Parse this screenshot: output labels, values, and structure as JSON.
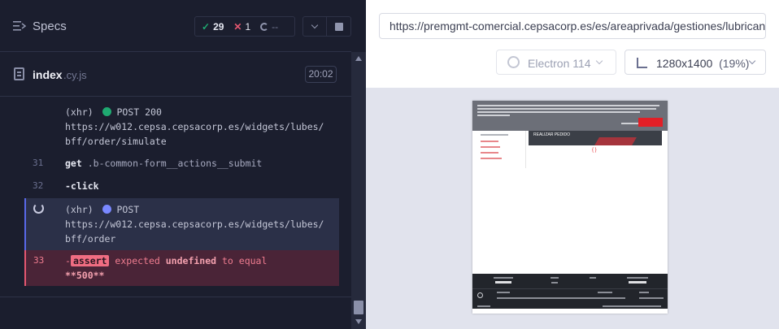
{
  "reporter": {
    "title": "Specs",
    "stats": {
      "passed": "29",
      "failed": "1",
      "pending": "--"
    },
    "file": {
      "name": "index",
      "ext": ".cy.js",
      "duration": "20:02"
    },
    "commands": [
      {
        "kind": "xhr",
        "prefix": "(xhr)",
        "method": "POST 200",
        "url": [
          "https://w012.cepsa.cepsacorp.es/widgets/lubes/",
          "bff/order/simulate"
        ]
      },
      {
        "kind": "get",
        "num": "31",
        "name": "get",
        "arg": ".b-common-form__actions__submit"
      },
      {
        "kind": "click",
        "num": "32",
        "name": "-click"
      },
      {
        "kind": "xhr-pending",
        "prefix": "(xhr)",
        "method": "POST",
        "url": [
          "https://w012.cepsa.cepsacorp.es/widgets/lubes/",
          "bff/order"
        ]
      },
      {
        "kind": "assert",
        "num": "33",
        "dash": "-",
        "badge": "assert",
        "expected": "expected",
        "value1": "undefined",
        "to_equal": "to equal",
        "value2": "**500**"
      }
    ]
  },
  "aut": {
    "url": "https://premgmt-comercial.cepsacorp.es/es/areaprivada/gestiones/lubricantes",
    "browser": "Electron 114",
    "viewport": "1280x1400",
    "scale": "(19%)",
    "preview": {
      "hero_title": "REALIZAR PEDIDO",
      "loader": "{ }"
    }
  }
}
